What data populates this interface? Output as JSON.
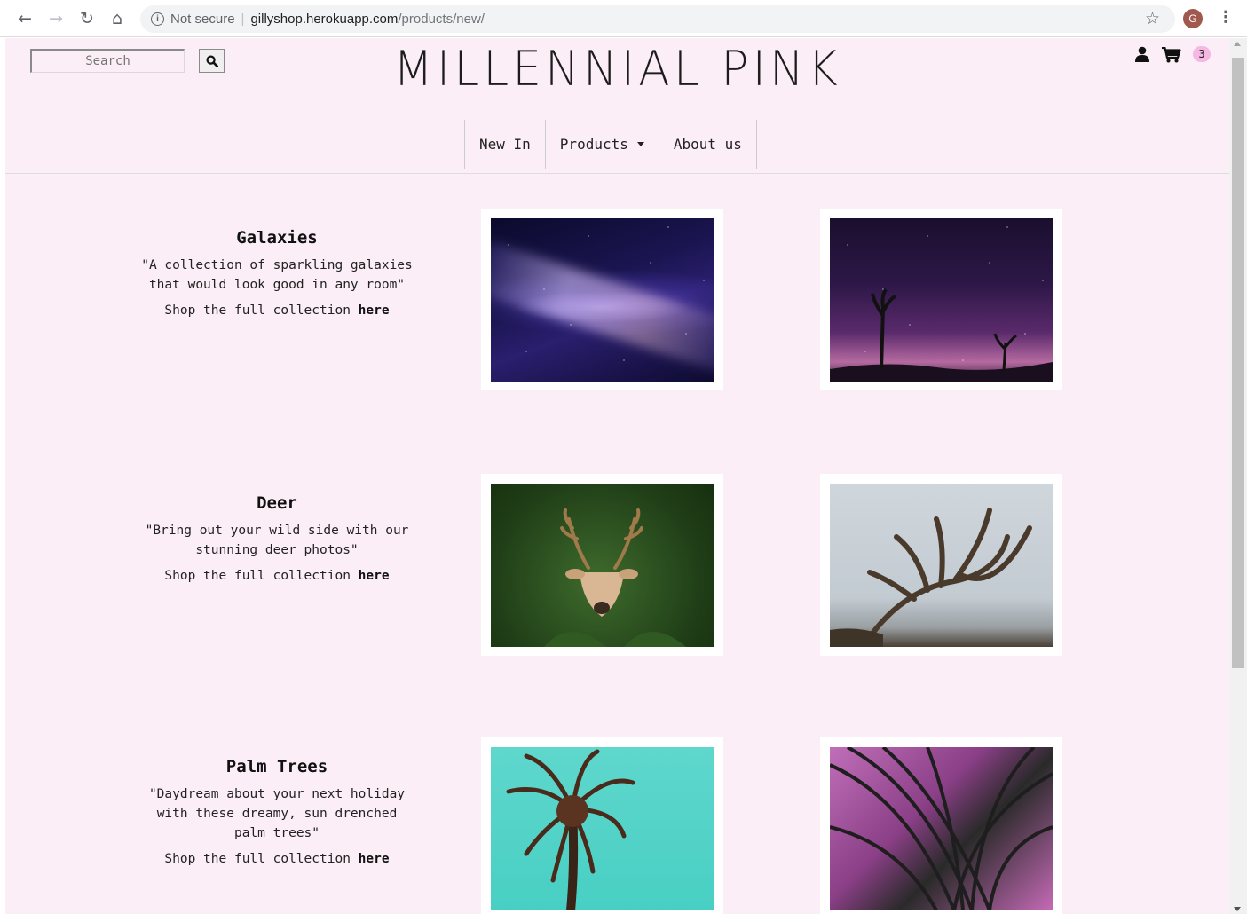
{
  "browser": {
    "security_label": "Not secure",
    "url_host": "gillyshop.herokuapp.com",
    "url_path": "/products/new/",
    "profile_initial": "G"
  },
  "header": {
    "search_placeholder": "Search",
    "logo_text": "MILLENNIAL PINK",
    "cart_count": "3",
    "nav": [
      {
        "label": "New In"
      },
      {
        "label": "Products"
      },
      {
        "label": "About us"
      }
    ]
  },
  "collections": [
    {
      "title": "Galaxies",
      "description": "\"A collection of sparkling galaxies that would look good in any room\"",
      "shop_text": "Shop the full collection",
      "shop_link": "here"
    },
    {
      "title": "Deer",
      "description": "\"Bring out your wild side with our stunning deer photos\"",
      "shop_text": "Shop the full collection",
      "shop_link": "here"
    },
    {
      "title": "Palm Trees",
      "description": "\"Daydream about your next holiday with these dreamy, sun drenched palm trees\"",
      "shop_text": "Shop the full collection",
      "shop_link": "here"
    }
  ],
  "colors": {
    "page_background": "#fbeef6",
    "cart_badge": "#f5b8e3"
  }
}
